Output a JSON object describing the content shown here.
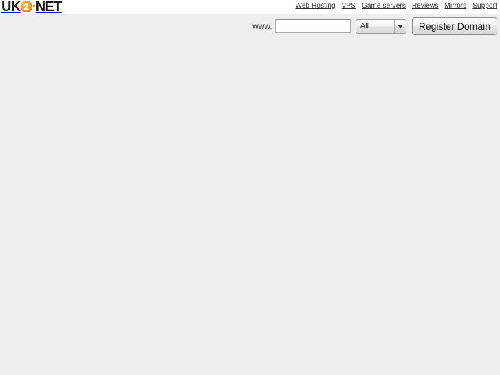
{
  "brand": {
    "logo_prefix": "UK",
    "logo_globe_digit": "2",
    "logo_suffix": "NET",
    "accent_color": "#f08a00"
  },
  "topnav": {
    "items": [
      {
        "label": "Web Hosting"
      },
      {
        "label": "VPS"
      },
      {
        "label": "Game servers"
      },
      {
        "label": "Reviews"
      },
      {
        "label": "Mirrors"
      },
      {
        "label": "Support"
      }
    ]
  },
  "domain_search": {
    "prefix_label": "www.",
    "input_value": "",
    "input_placeholder": "",
    "tld_selected": "All",
    "tld_options": [
      "All"
    ],
    "submit_label": "Register Domain"
  },
  "page": {
    "background_color": "#eeeeee",
    "header_background_color": "#ffffff",
    "content": ""
  }
}
